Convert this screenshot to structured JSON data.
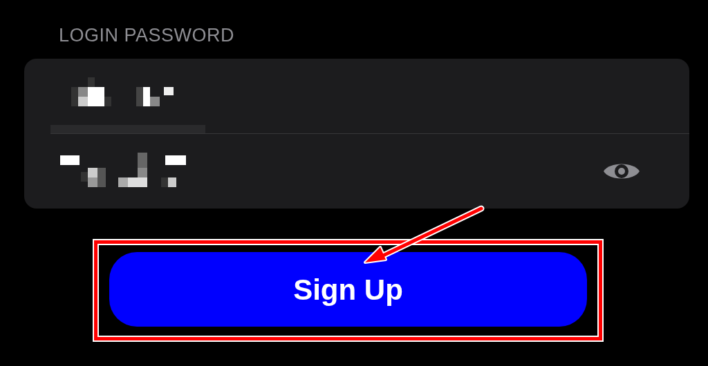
{
  "section_label": "LOGIN PASSWORD",
  "fields": [
    {
      "kind": "text"
    },
    {
      "kind": "password"
    }
  ],
  "button": {
    "label": "Sign Up",
    "highlighted": true
  }
}
